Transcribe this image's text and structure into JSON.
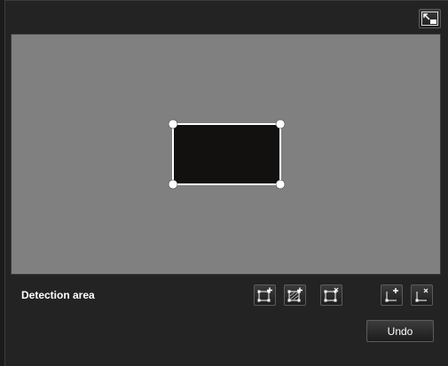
{
  "detection": {
    "label": "Detection area"
  },
  "buttons": {
    "undo_label": "Undo"
  },
  "icons": {
    "expand": "expand-icon",
    "add_area": "add-area-icon",
    "add_mask_area": "add-mask-area-icon",
    "delete_area": "delete-area-icon",
    "add_vertex": "add-vertex-icon",
    "delete_vertex": "delete-vertex-icon"
  },
  "colors": {
    "background": "#232323",
    "preview": "#808080",
    "area_fill": "#121110",
    "area_outline": "#ffffff"
  }
}
